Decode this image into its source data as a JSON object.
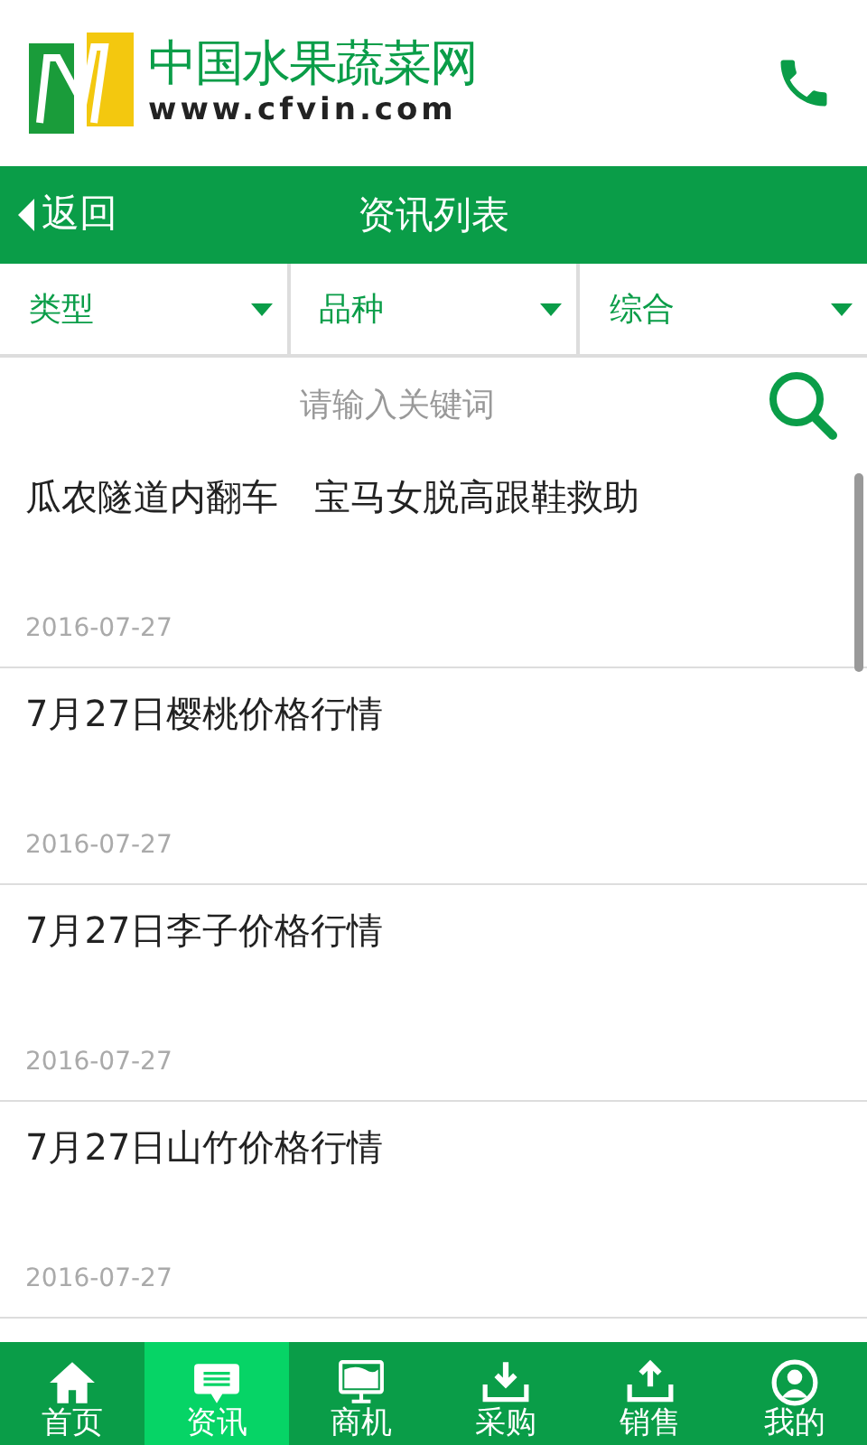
{
  "header": {
    "site_name": "中国水果蔬菜网",
    "site_url": "www.cfvin.com"
  },
  "title_bar": {
    "back": "返回",
    "title": "资讯列表"
  },
  "filters": [
    {
      "label": "类型"
    },
    {
      "label": "品种"
    },
    {
      "label": "综合"
    }
  ],
  "search": {
    "placeholder": "请输入关键词"
  },
  "articles": [
    {
      "title": "瓜农隧道内翻车　宝马女脱高跟鞋救助",
      "date": "2016-07-27"
    },
    {
      "title": "7月27日樱桃价格行情",
      "date": "2016-07-27"
    },
    {
      "title": "7月27日李子价格行情",
      "date": "2016-07-27"
    },
    {
      "title": "7月27日山竹价格行情",
      "date": "2016-07-27"
    }
  ],
  "tab_bar": [
    {
      "label": "首页",
      "selected": false
    },
    {
      "label": "资讯",
      "selected": true
    },
    {
      "label": "商机",
      "selected": false
    },
    {
      "label": "采购",
      "selected": false
    },
    {
      "label": "销售",
      "selected": false
    },
    {
      "label": "我的",
      "selected": false
    }
  ]
}
